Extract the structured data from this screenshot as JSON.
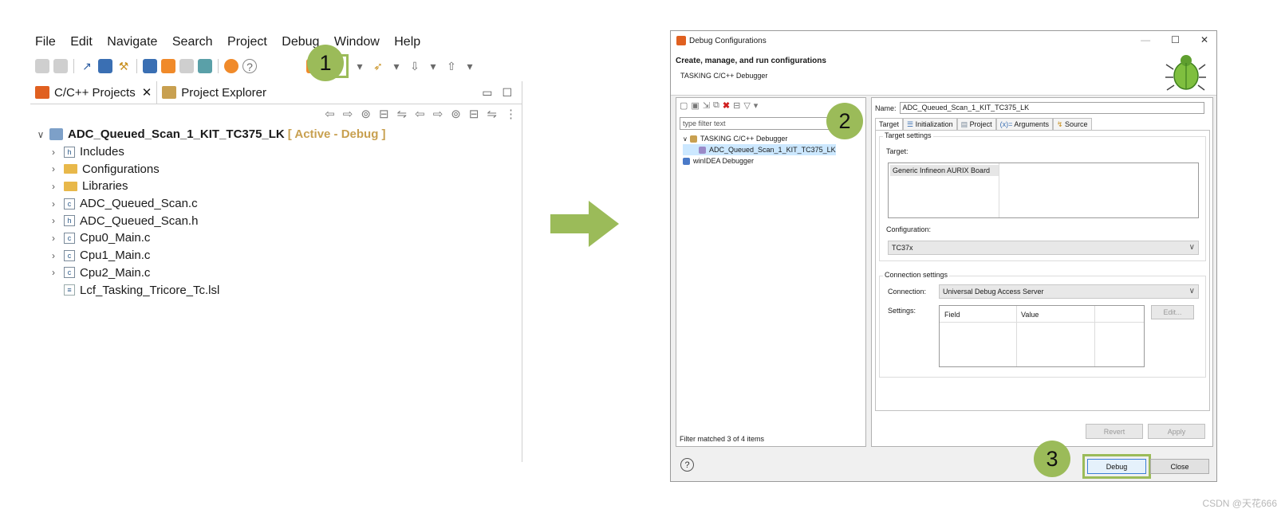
{
  "ide": {
    "menu": [
      "File",
      "Edit",
      "Navigate",
      "Search",
      "Project",
      "Debug",
      "Window",
      "Help"
    ],
    "tabs": [
      {
        "label": "C/C++ Projects",
        "close": "✕"
      },
      {
        "label": "Project Explorer"
      }
    ],
    "project": {
      "name": "ADC_Queued_Scan_1_KIT_TC375_LK",
      "state": "[ Active - Debug ]"
    },
    "tree": [
      {
        "label": "Includes",
        "icon": "includes-icon"
      },
      {
        "label": "Configurations",
        "icon": "folder-icon"
      },
      {
        "label": "Libraries",
        "icon": "folder-icon"
      },
      {
        "label": "ADC_Queued_Scan.c",
        "icon": "c-file-icon"
      },
      {
        "label": "ADC_Queued_Scan.h",
        "icon": "h-file-icon"
      },
      {
        "label": "Cpu0_Main.c",
        "icon": "c-file-icon"
      },
      {
        "label": "Cpu1_Main.c",
        "icon": "c-file-icon"
      },
      {
        "label": "Cpu2_Main.c",
        "icon": "c-file-icon"
      },
      {
        "label": "Lcf_Tasking_Tricore_Tc.lsl",
        "icon": "text-file-icon"
      }
    ]
  },
  "steps": {
    "one": "1",
    "two": "2",
    "three": "3"
  },
  "dialog": {
    "title": "Debug Configurations",
    "header_title": "Create, manage, and run configurations",
    "header_subtitle": "TASKING C/C++ Debugger",
    "filter_placeholder": "type filter text",
    "tree": [
      {
        "label": "TASKING C/C++ Debugger"
      },
      {
        "label": "ADC_Queued_Scan_1_KIT_TC375_LK"
      },
      {
        "label": "winIDEA Debugger"
      }
    ],
    "filter_status": "Filter matched 3 of 4 items",
    "name_label": "Name:",
    "name_value": "ADC_Queued_Scan_1_KIT_TC375_LK",
    "tabs": [
      "Target",
      "Initialization",
      "Project",
      "Arguments",
      "Source"
    ],
    "target_settings": "Target settings",
    "target_label": "Target:",
    "target_item": "Generic Infineon AURIX Board",
    "configuration_label": "Configuration:",
    "configuration_value": "TC37x",
    "connection_settings": "Connection settings",
    "connection_label": "Connection:",
    "connection_value": "Universal Debug Access Server",
    "settings_label": "Settings:",
    "settings_columns": [
      "Field",
      "Value"
    ],
    "edit_button": "Edit...",
    "revert_button": "Revert",
    "apply_button": "Apply",
    "debug_button": "Debug",
    "close_button": "Close",
    "help": "?",
    "win_buttons": {
      "min": "—",
      "max": "☐",
      "close": "✕"
    }
  },
  "watermark": "CSDN @天花666",
  "colors": {
    "highlight": "#9bbb59",
    "arrow": "#9bbb59"
  }
}
